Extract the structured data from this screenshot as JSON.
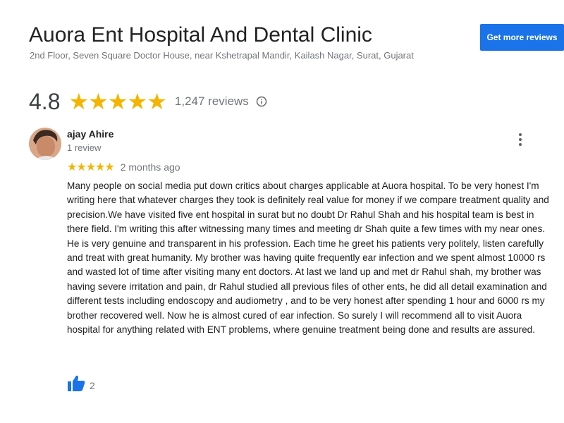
{
  "business": {
    "name": "Auora Ent Hospital And Dental Clinic",
    "address": "2nd Floor, Seven Square Doctor House, near Kshetrapal Mandir, Kailash Nagar, Surat, Gujarat",
    "rating": "4.8",
    "rating_value": 4.8,
    "stars": "★★★★★",
    "review_count": "1,247 reviews"
  },
  "actions": {
    "get_more_reviews": "Get more reviews"
  },
  "review": {
    "author": "ajay Ahire",
    "author_meta": "1 review",
    "stars": "★★★★★",
    "star_count": 5,
    "time_ago": "2 months ago",
    "text": "Many people on social media put down critics about charges applicable at Auora hospital. To be very honest I'm writing here that whatever charges they took is definitely real value for money if we compare treatment quality and precision.We have visited five ent hospital in surat but no doubt Dr Rahul Shah and his hospital team is best in there field. I'm writing this after witnessing many times and meeting dr Shah quite a few times with my near ones. He is very genuine and transparent in his profession. Each time he greet his patients very politely, listen carefully and treat with great humanity. My brother was having quite frequently ear infection and we spent almost 10000 rs and wasted lot of time after visiting many ent doctors. At last we land up and met dr Rahul shah, my brother was having severe irritation and pain, dr Rahul studied all previous files of other ents, he did all detail examination and different tests including endoscopy and audiometry , and to be very honest after spending 1 hour and 6000 rs my brother recovered well. Now he is almost cured of ear infection. So surely I will recommend all to visit Auora hospital for anything related with ENT problems, where genuine treatment being done and results are assured.",
    "likes": "2"
  },
  "colors": {
    "accent": "#1a73e8",
    "star": "#f4b400",
    "secondary_text": "#70757a"
  },
  "icons": {
    "info": "info-icon",
    "more": "more-vert-icon",
    "like": "thumbs-up-icon"
  }
}
